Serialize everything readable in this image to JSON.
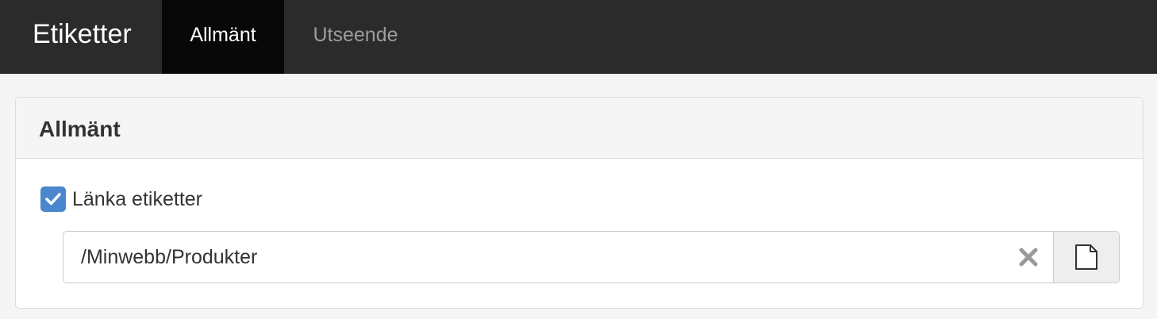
{
  "nav": {
    "brand": "Etiketter",
    "tabs": [
      {
        "label": "Allmänt",
        "active": true
      },
      {
        "label": "Utseende",
        "active": false
      }
    ]
  },
  "panel": {
    "title": "Allmänt",
    "link_tags": {
      "label": "Länka etiketter",
      "checked": true
    },
    "path_input": {
      "value": "/Minwebb/Produkter"
    },
    "clear_icon": "close-icon",
    "browse_icon": "file-icon"
  },
  "colors": {
    "navbar_bg": "#2b2b2b",
    "active_tab_bg": "#080808",
    "checkbox_blue": "#4a87cf"
  }
}
